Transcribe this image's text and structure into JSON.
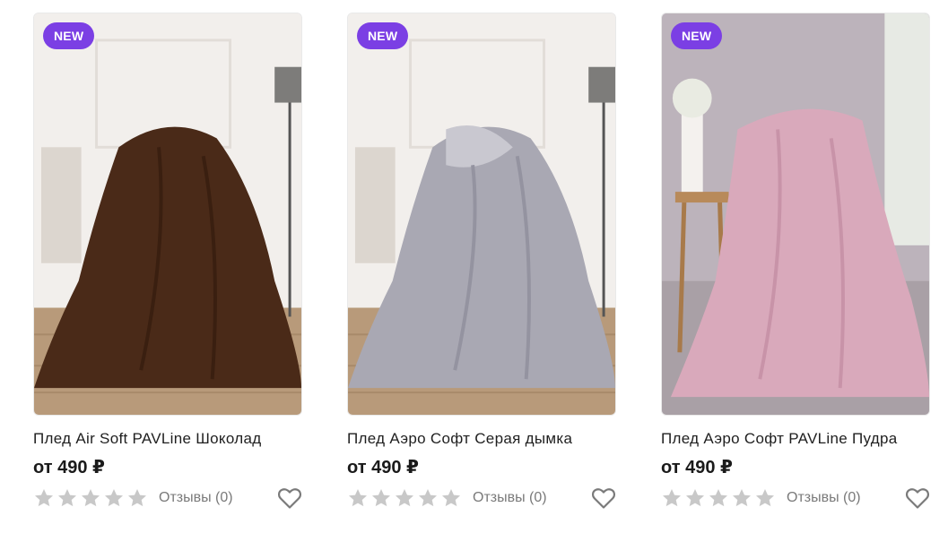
{
  "products": [
    {
      "badge": "NEW",
      "title": "Плед Air Soft PAVLine Шоколад",
      "price": "от 490 ₽",
      "reviews": "Отзывы (0)",
      "rating": 0,
      "blanket_color": "#4a2a18"
    },
    {
      "badge": "NEW",
      "title": "Плед Аэро Софт Серая дымка",
      "price": "от 490 ₽",
      "reviews": "Отзывы (0)",
      "rating": 0,
      "blanket_color": "#a9a8b3"
    },
    {
      "badge": "NEW",
      "title": "Плед Аэро Софт PAVLine Пудра",
      "price": "от 490 ₽",
      "reviews": "Отзывы (0)",
      "rating": 0,
      "blanket_color": "#d9a9bb"
    }
  ],
  "colors": {
    "badge_bg": "#7b3fe4",
    "star_empty": "#c8c8c8",
    "heart_outline": "#7a7a7a"
  },
  "icons": {
    "star": "star-icon",
    "favorite": "heart-icon"
  }
}
